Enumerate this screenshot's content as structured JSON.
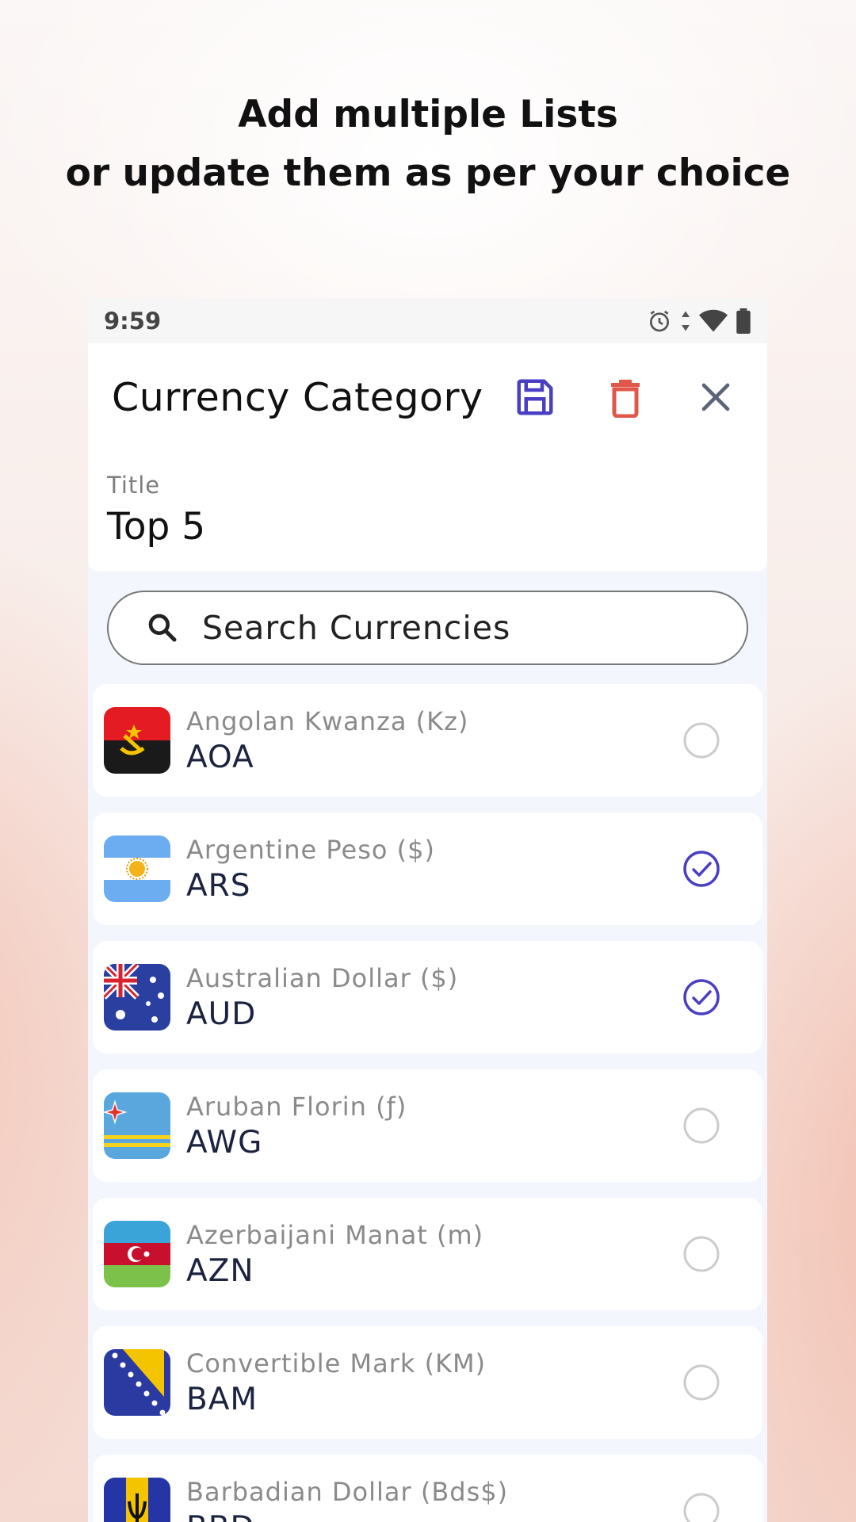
{
  "headline": {
    "line1": "Add multiple Lists",
    "line2": "or update them as per your choice"
  },
  "statusbar": {
    "time": "9:59"
  },
  "appbar": {
    "title": "Currency Category",
    "save_icon": "save-icon",
    "delete_icon": "trash-icon",
    "close_icon": "close-icon"
  },
  "form": {
    "title_label": "Title",
    "title_value": "Top 5"
  },
  "search": {
    "placeholder": "Search Currencies"
  },
  "currencies": [
    {
      "name": "Angolan Kwanza (Kz)",
      "code": "AOA",
      "selected": false
    },
    {
      "name": "Argentine Peso ($)",
      "code": "ARS",
      "selected": true
    },
    {
      "name": "Australian Dollar ($)",
      "code": "AUD",
      "selected": true
    },
    {
      "name": "Aruban Florin (ƒ)",
      "code": "AWG",
      "selected": false
    },
    {
      "name": "Azerbaijani Manat (m)",
      "code": "AZN",
      "selected": false
    },
    {
      "name": "Convertible Mark (KM)",
      "code": "BAM",
      "selected": false
    },
    {
      "name": "Barbadian Dollar (Bds$)",
      "code": "BBD",
      "selected": false
    }
  ],
  "colors": {
    "accent": "#4a3fc4",
    "delete": "#e0574a",
    "close": "#5b6478",
    "unchecked": "#cccccc"
  }
}
